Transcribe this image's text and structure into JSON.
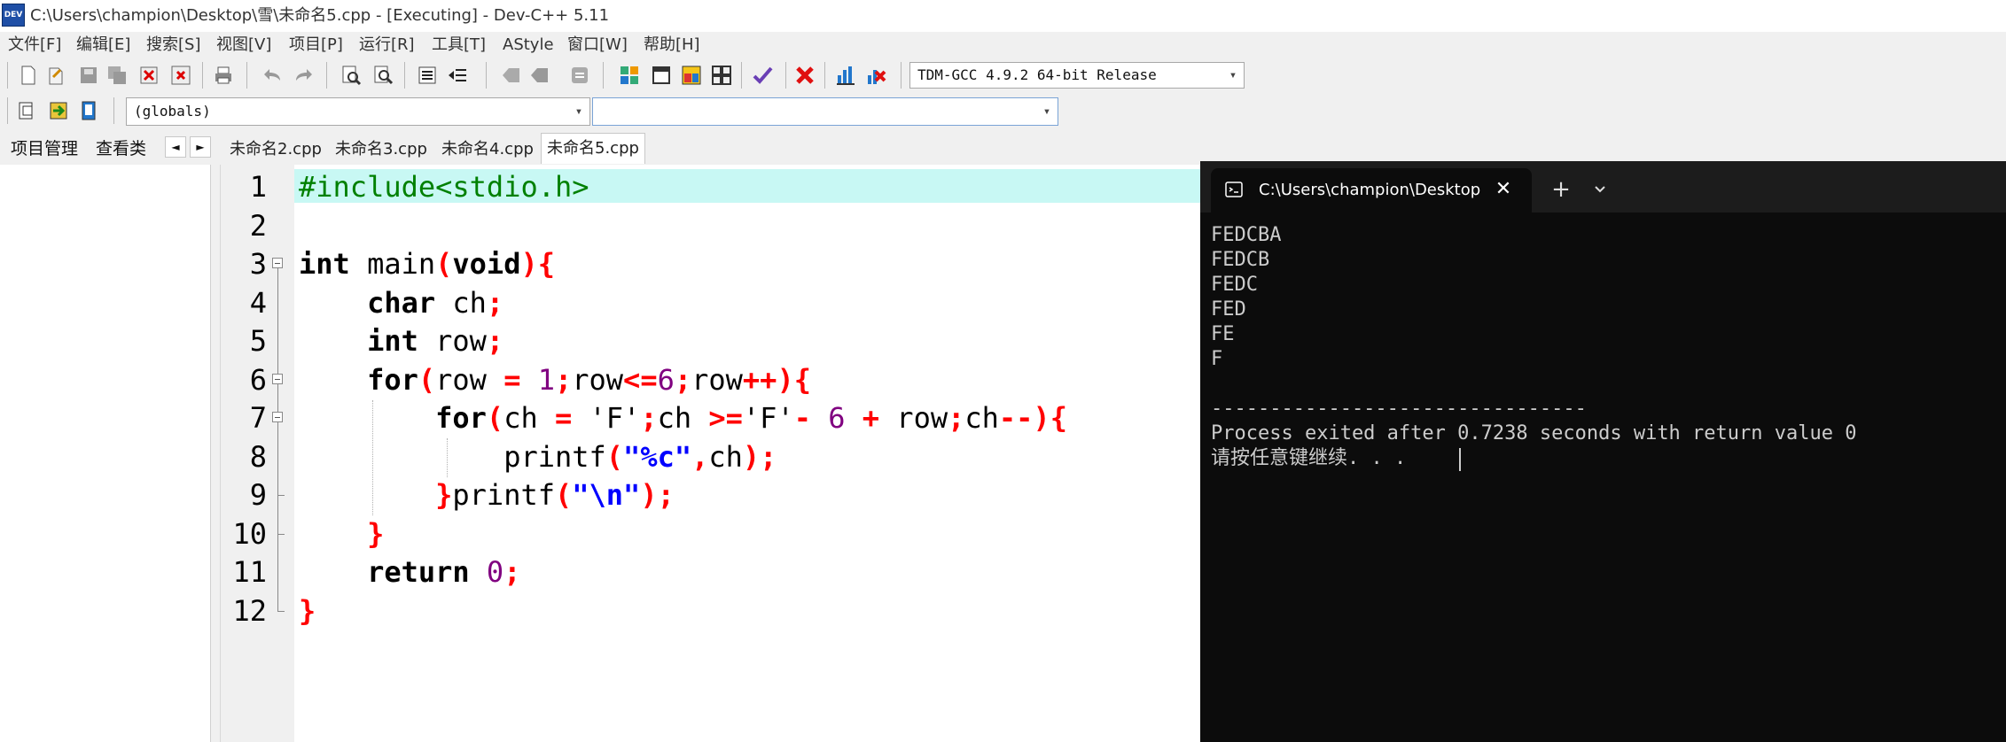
{
  "window": {
    "title": "C:\\Users\\champion\\Desktop\\雪\\未命名5.cpp - [Executing] - Dev-C++ 5.11",
    "app_icon_text": "DEV"
  },
  "menu": [
    "文件[F]",
    "编辑[E]",
    "搜索[S]",
    "视图[V]",
    "项目[P]",
    "运行[R]",
    "工具[T]",
    "AStyle",
    "窗口[W]",
    "帮助[H]"
  ],
  "toolbar": {
    "compiler_select": "TDM-GCC 4.9.2 64-bit Release",
    "scope_select": "(globals)",
    "function_select": ""
  },
  "left_panel": {
    "tabs": [
      "项目管理",
      "查看类"
    ],
    "nav_prev": "◄",
    "nav_next": "►"
  },
  "editor": {
    "tabs": [
      "未命名2.cpp",
      "未命名3.cpp",
      "未命名4.cpp",
      "未命名5.cpp"
    ],
    "active_tab": "未命名5.cpp",
    "line_numbers": [
      "1",
      "2",
      "3",
      "4",
      "5",
      "6",
      "7",
      "8",
      "9",
      "10",
      "11",
      "12"
    ],
    "current_line": 1
  },
  "code": {
    "l1": "#include<stdio.h>",
    "l3": {
      "type": "int",
      "name": " main",
      "open": "(",
      "param": "void",
      "close": "){"
    },
    "l4": {
      "indent": "    ",
      "type": "char",
      "rest": " ch",
      "semi": ";"
    },
    "l5": {
      "indent": "    ",
      "type": "int",
      "rest": " row",
      "semi": ";"
    },
    "l6": {
      "indent": "    ",
      "kw": "for",
      "p_open": "(",
      "a": "row ",
      "eq": "=",
      "sp": " ",
      "one": "1",
      "semi1": ";",
      "b": "row",
      "le": "<=",
      "six": "6",
      "semi2": ";",
      "c": "row",
      "inc": "++",
      "p_close": "){"
    },
    "l7": {
      "indent": "        ",
      "kw": "for",
      "p_open": "(",
      "a": "ch ",
      "eq": "=",
      "b": " 'F'",
      "semi1": ";",
      "c": "ch ",
      "ge": ">=",
      "d": "'F'",
      "minus": "-",
      "sp1": " ",
      "six": "6",
      "sp2": " ",
      "plus": "+",
      "e": " row",
      "semi2": ";",
      "f": "ch",
      "dec": "--",
      "p_close": "){"
    },
    "l8": {
      "indent": "            ",
      "fn": "printf",
      "p_open": "(",
      "str": "\"%c\"",
      "comma": ",",
      "arg": "ch",
      "p_close": ");"
    },
    "l9": {
      "indent": "        ",
      "brace": "}",
      "fn": "printf",
      "p_open": "(",
      "str": "\"\\n\"",
      "p_close": ");"
    },
    "l10": {
      "indent": "    ",
      "brace": "}"
    },
    "l11": {
      "indent": "    ",
      "kw": "return",
      "sp": " ",
      "zero": "0",
      "semi": ";"
    },
    "l12": {
      "brace": "}"
    }
  },
  "terminal": {
    "tab_title": "C:\\Users\\champion\\Desktop\\雪",
    "close": "✕",
    "plus": "+",
    "output": [
      "FEDCBA",
      "FEDCB",
      "FEDC",
      "FED",
      "FE",
      "F",
      "",
      "--------------------------------",
      "Process exited after 0.7238 seconds with return value 0",
      "请按任意键继续. . ."
    ]
  },
  "colors": {
    "current_line_bg": "#c8f8f4",
    "keyword": "#000000",
    "preprocessor": "#008000",
    "symbol": "#ff0000",
    "number": "#800080",
    "string": "#0000ff",
    "terminal_bg": "#0c0c0c",
    "terminal_text": "#cccccc"
  }
}
